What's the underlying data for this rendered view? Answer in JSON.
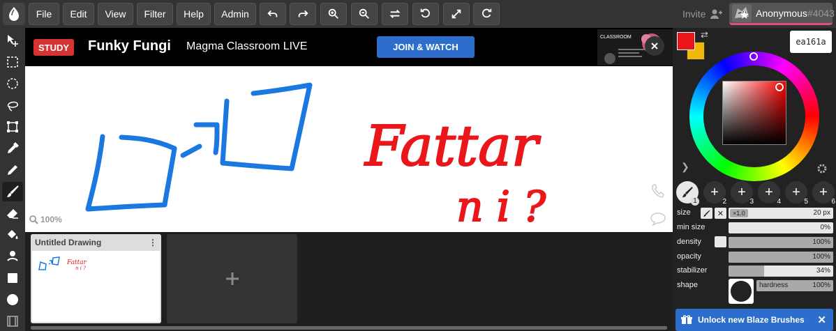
{
  "menu": {
    "items": [
      "File",
      "Edit",
      "View",
      "Filter",
      "Help",
      "Admin"
    ],
    "icons": [
      "undo-icon",
      "redo-icon",
      "zoom-in-icon",
      "zoom-out-icon",
      "flip-icon",
      "rotate-icon",
      "fullscreen-icon",
      "reset-icon"
    ]
  },
  "account": {
    "invite_label": "Invite",
    "user_name": "Anonymous",
    "user_number": "#4043"
  },
  "tools": [
    "move-tool",
    "select-tool",
    "lasso-ellipse-tool",
    "lasso-tool",
    "transform-tool",
    "eyedropper-tool",
    "pencil-tool",
    "brush-tool",
    "eraser-tool",
    "fill-tool",
    "smudge-tool",
    "rectangle-tool",
    "circle-tool",
    "film-tool"
  ],
  "ad": {
    "tag": "STUDY",
    "title": "Funky Fungi",
    "subtitle": "Magma Classroom LIVE",
    "cta": "JOIN & WATCH",
    "thumb_text": "CLASSROOM"
  },
  "canvas": {
    "zoom": "100%",
    "text_top": "Fattar",
    "text_bottom": "n i ?"
  },
  "documents": {
    "items": [
      {
        "title": "Untitled Drawing"
      }
    ]
  },
  "color": {
    "primary": "#ea161a",
    "secondary": "#f2b90d",
    "hex": "ea161a"
  },
  "brushes": {
    "selected": 1,
    "slots": [
      "1",
      "2",
      "3",
      "4",
      "5",
      "6"
    ]
  },
  "properties": {
    "size_label": "size",
    "size_mult": "×1.0",
    "size_value": "20 px",
    "min_size_label": "min size",
    "min_size_value": "0%",
    "min_size_fill": 0,
    "density_label": "density",
    "density_value": "100%",
    "density_fill": 1.0,
    "opacity_label": "opacity",
    "opacity_value": "100%",
    "opacity_fill": 1.0,
    "stabilizer_label": "stabilizer",
    "stabilizer_value": "34%",
    "stabilizer_fill": 0.34,
    "shape_label": "shape",
    "hardness_label": "hardness",
    "hardness_value": "100%",
    "hardness_fill": 1.0
  },
  "promo": {
    "label": "Unlock new Blaze Brushes"
  }
}
